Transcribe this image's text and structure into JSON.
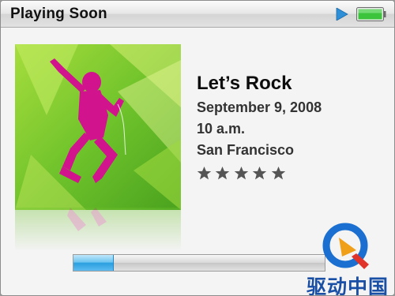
{
  "header": {
    "title": "Playing Soon",
    "play_icon": "play-icon",
    "battery_icon": "battery-icon",
    "colors": {
      "play": "#2e8fd6",
      "battery": "#3cc43c"
    }
  },
  "now_playing": {
    "song": "Let’s Rock",
    "date": "September 9, 2008",
    "time": "10 a.m.",
    "location": "San Francisco",
    "rating": {
      "filled": 0,
      "total": 5,
      "star_color": "#555555"
    },
    "progress": 0.16
  },
  "art": {
    "subject": "silhouette-dancer",
    "colors": {
      "bg": "#7cc833",
      "figure": "#d1148e"
    }
  },
  "watermark": {
    "text": "驱动中国"
  }
}
